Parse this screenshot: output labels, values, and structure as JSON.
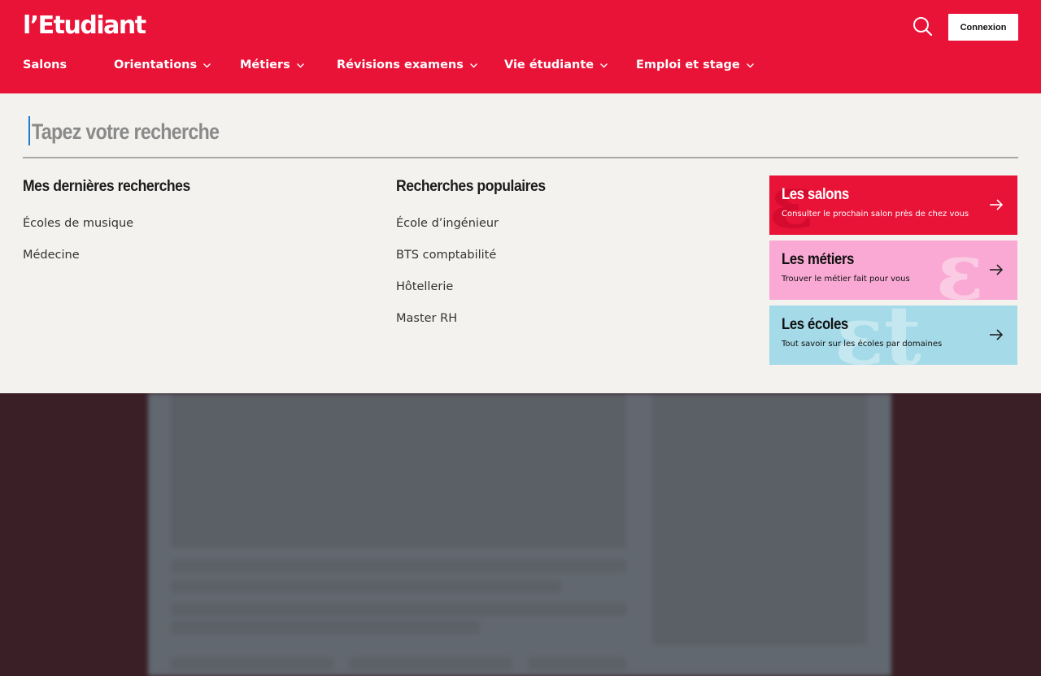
{
  "header": {
    "logo": "l’Etudiant",
    "connexion_label": "Connexion",
    "search_icon": "search-icon",
    "brand_color": "#e91237"
  },
  "nav": {
    "items": [
      {
        "label": "Salons",
        "has_dropdown": false
      },
      {
        "label": "Orientations",
        "has_dropdown": true
      },
      {
        "label": "Métiers",
        "has_dropdown": true
      },
      {
        "label": "Révisions examens",
        "has_dropdown": true
      },
      {
        "label": "Vie étudiante",
        "has_dropdown": true
      },
      {
        "label": "Emploi et stage",
        "has_dropdown": true
      }
    ]
  },
  "search": {
    "placeholder": "Tapez votre recherche",
    "value": ""
  },
  "recent": {
    "title": "Mes dernières recherches",
    "items": [
      "Écoles de musique",
      "Médecine"
    ]
  },
  "popular": {
    "title": "Recherches populaires",
    "items": [
      "École d’ingénieur",
      "BTS comptabilité",
      "Hôtellerie",
      "Master RH"
    ]
  },
  "cards": [
    {
      "title": "Les salons",
      "subtitle": "Consulter le prochain salon près de chez vous",
      "color": "#e91237",
      "icon": "arrow-right-icon"
    },
    {
      "title": "Les métiers",
      "subtitle": "Trouver le métier fait pour vous",
      "color": "#f9a9d3",
      "icon": "arrow-right-icon"
    },
    {
      "title": "Les écoles",
      "subtitle": "Tout savoir sur les écoles par domaines",
      "color": "#a5dae8",
      "icon": "arrow-right-icon"
    }
  ]
}
